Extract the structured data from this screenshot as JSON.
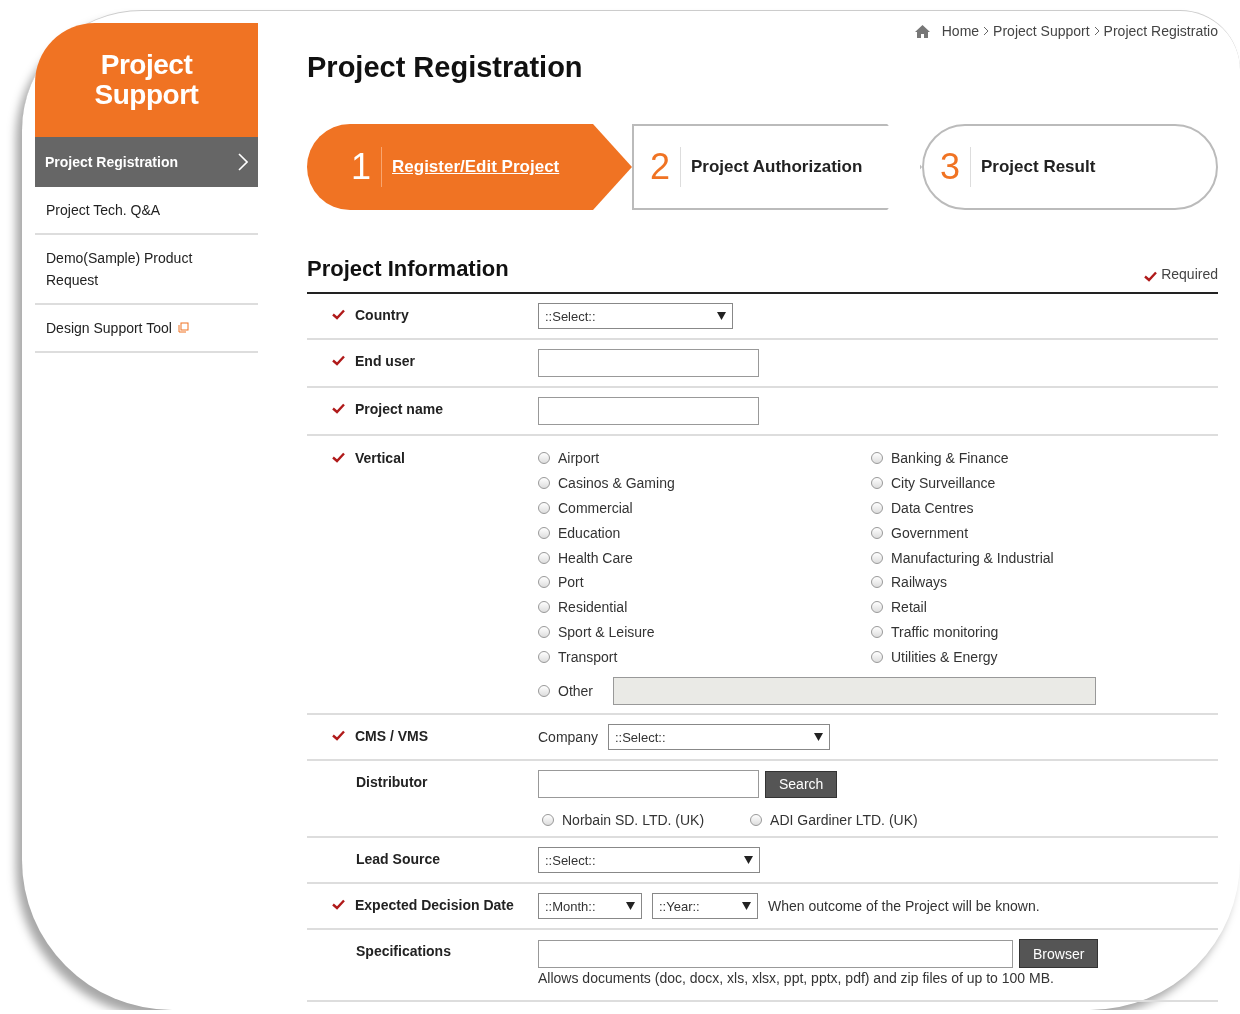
{
  "sidebar": {
    "title": "Project Support",
    "items": [
      {
        "label": "Project Registration",
        "selected": true,
        "external": false
      },
      {
        "label": "Project Tech. Q&A",
        "selected": false,
        "external": false
      },
      {
        "label": "Demo(Sample) Product Request",
        "selected": false,
        "external": false
      },
      {
        "label": "Design Support Tool",
        "selected": false,
        "external": true
      }
    ]
  },
  "breadcrumb": [
    "Home",
    "Project Support",
    "Project Registratio"
  ],
  "page_title": "Project Registration",
  "steps": [
    {
      "number": "1",
      "label": "Register/Edit Project",
      "selected": true
    },
    {
      "number": "2",
      "label": "Project Authorization",
      "selected": false
    },
    {
      "number": "3",
      "label": "Project Result",
      "selected": false
    }
  ],
  "section": {
    "title": "Project Information",
    "required_note": "Required"
  },
  "rows": [
    {
      "kind": "select",
      "label": "Country",
      "required": true,
      "value": "::Select::"
    },
    {
      "kind": "text",
      "label": "End user",
      "required": true
    },
    {
      "kind": "text",
      "label": "Project name",
      "required": true
    },
    {
      "kind": "radios",
      "label": "Vertical",
      "required": true,
      "options": [
        {
          "label": "Airport",
          "selected": false
        },
        {
          "label": "Casinos & Gaming",
          "selected": false
        },
        {
          "label": "Commercial",
          "selected": false
        },
        {
          "label": "Education",
          "selected": false
        },
        {
          "label": "Health Care",
          "selected": false
        },
        {
          "label": "Port",
          "selected": false
        },
        {
          "label": "Residential",
          "selected": false
        },
        {
          "label": "Sport & Leisure",
          "selected": false
        },
        {
          "label": "Transport",
          "selected": false
        },
        {
          "label": "Banking & Finance",
          "selected": false
        },
        {
          "label": "City Surveillance",
          "selected": false
        },
        {
          "label": "Data Centres",
          "selected": false
        },
        {
          "label": "Government",
          "selected": false
        },
        {
          "label": "Manufacturing & Industrial",
          "selected": false
        },
        {
          "label": "Railways",
          "selected": false
        },
        {
          "label": "Retail",
          "selected": false
        },
        {
          "label": "Traffic monitoring",
          "selected": false
        },
        {
          "label": "Utilities & Energy",
          "selected": false
        }
      ],
      "other": {
        "label": "Other",
        "selected": false,
        "disabled": true
      }
    },
    {
      "kind": "company",
      "label": "CMS / VMS",
      "required": true,
      "prefix": "Company",
      "value": "::Select::"
    },
    {
      "kind": "distributor",
      "label": "Distributor",
      "required": false,
      "button": "Search",
      "options": [
        {
          "label": "Norbain SD. LTD. (UK)",
          "selected": false
        },
        {
          "label": "ADI Gardiner LTD. (UK)",
          "selected": false
        }
      ]
    },
    {
      "kind": "select",
      "label": "Lead Source",
      "required": false,
      "value": "::Select::"
    },
    {
      "kind": "dates",
      "label": "Expected Decision Date",
      "required": true,
      "month": "::Month::",
      "year": "::Year::",
      "note": "When outcome of the Project will be known."
    },
    {
      "kind": "file",
      "label": "Specifications",
      "required": false,
      "button": "Browser",
      "note": "Allows documents (doc, docx, xls, xlsx, ppt, pptx, pdf) and zip files of up to 100 MB."
    }
  ]
}
